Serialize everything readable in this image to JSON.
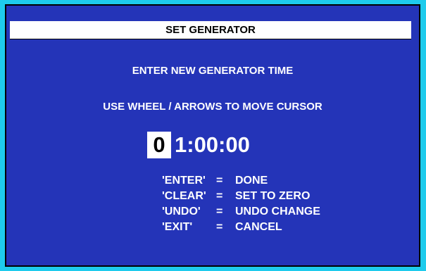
{
  "title": "SET GENERATOR",
  "line1": "ENTER NEW GENERATOR TIME",
  "line2": "USE WHEEL / ARROWS TO MOVE CURSOR",
  "time": {
    "cursor_digit": "0",
    "rest": "1:00:00"
  },
  "keys": [
    {
      "key": "'ENTER'",
      "eq": "=",
      "action": "DONE"
    },
    {
      "key": "'CLEAR'",
      "eq": "=",
      "action": "SET TO ZERO"
    },
    {
      "key": "'UNDO'",
      "eq": "=",
      "action": "UNDO CHANGE"
    },
    {
      "key": "'EXIT'",
      "eq": "=",
      "action": "CANCEL"
    }
  ]
}
